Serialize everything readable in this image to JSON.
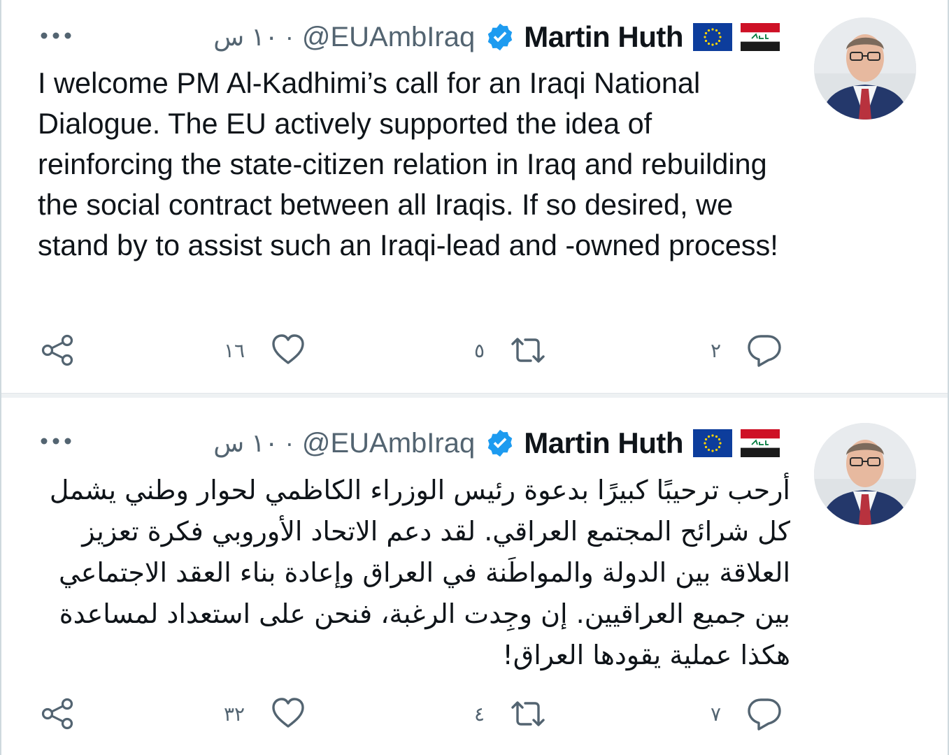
{
  "tweets": [
    {
      "name": "Martin Huth",
      "handle": "@EUAmbIraq",
      "time": "١٠ س ·",
      "text": "I welcome PM Al-Kadhimi’s call for an Iraqi National Dialogue. The EU actively supported the idea of reinforcing the state-citizen relation in Iraq and rebuilding the social contract between all Iraqis. If so desired, we stand by to assist such an Iraqi-lead and -owned process!",
      "replies": "٢",
      "retweets": "٥",
      "likes": "١٦"
    },
    {
      "name": "Martin Huth",
      "handle": "@EUAmbIraq",
      "time": "١٠ س ·",
      "text": "أرحب ترحيبًا كبيرًا بدعوة رئيس الوزراء الكاظمي لحوار وطني يشمل كل شرائح المجتمع العراقي. لقد دعم الاتحاد الأوروبي فكرة تعزيز العلاقة بين الدولة والمواطَنة في العراق وإعادة بناء العقد الاجتماعي بين جميع العراقيين. إن وجِدت الرغبة، فنحن على استعداد لمساعدة هكذا عملية يقودها العراق!",
      "replies": "٧",
      "retweets": "٤",
      "likes": "٣٢"
    }
  ],
  "icons": {
    "verified": "verified-badge-icon",
    "more": "more-options-icon",
    "reply": "reply-icon",
    "retweet": "retweet-icon",
    "like": "like-icon",
    "share": "share-icon",
    "flag_iraq": "iraq-flag-icon",
    "flag_eu": "eu-flag-icon"
  },
  "colors": {
    "verified_blue": "#1d9bf0",
    "secondary_text": "#536471",
    "primary_text": "#0f1419"
  }
}
